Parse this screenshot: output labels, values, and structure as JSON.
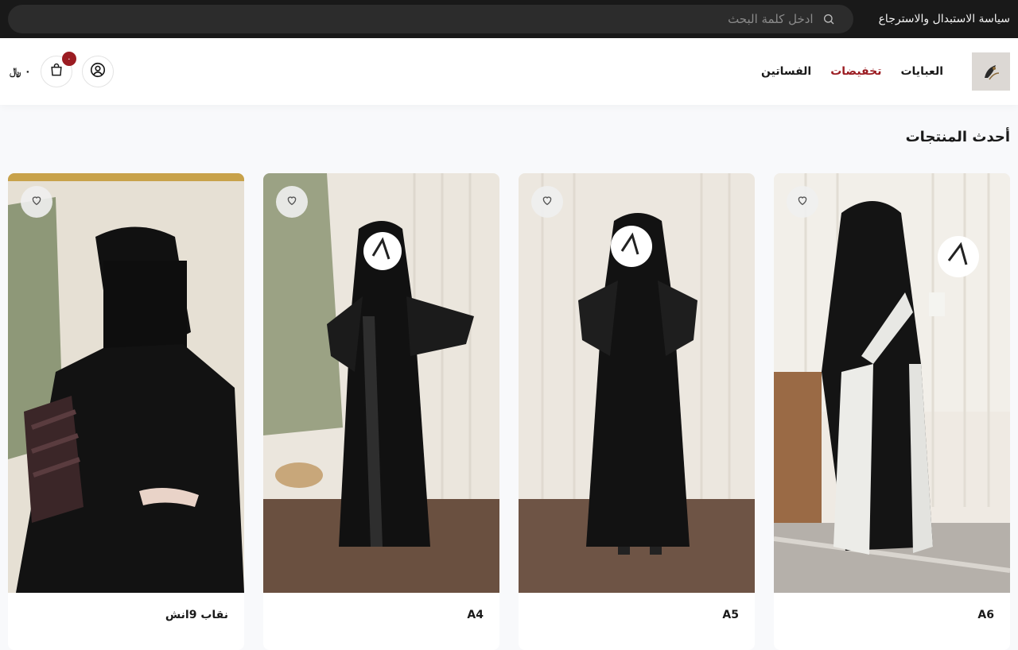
{
  "topbar": {
    "policy_link": "سياسة الاستبدال والاسترجاع",
    "search_placeholder": "ادخل كلمة البحث"
  },
  "header": {
    "nav": [
      {
        "label": "العبايات"
      },
      {
        "label": "تخفيضات"
      },
      {
        "label": "الفساتين"
      }
    ],
    "cart_count": "٠",
    "cart_total": "٠ ﷼"
  },
  "section": {
    "title": "أحدث المنتجات"
  },
  "products": [
    {
      "name": "A6"
    },
    {
      "name": "A5"
    },
    {
      "name": "A4"
    },
    {
      "name": "نقاب 9انش"
    }
  ],
  "colors": {
    "topbar_bg": "#191919",
    "accent": "#9b1c22"
  }
}
